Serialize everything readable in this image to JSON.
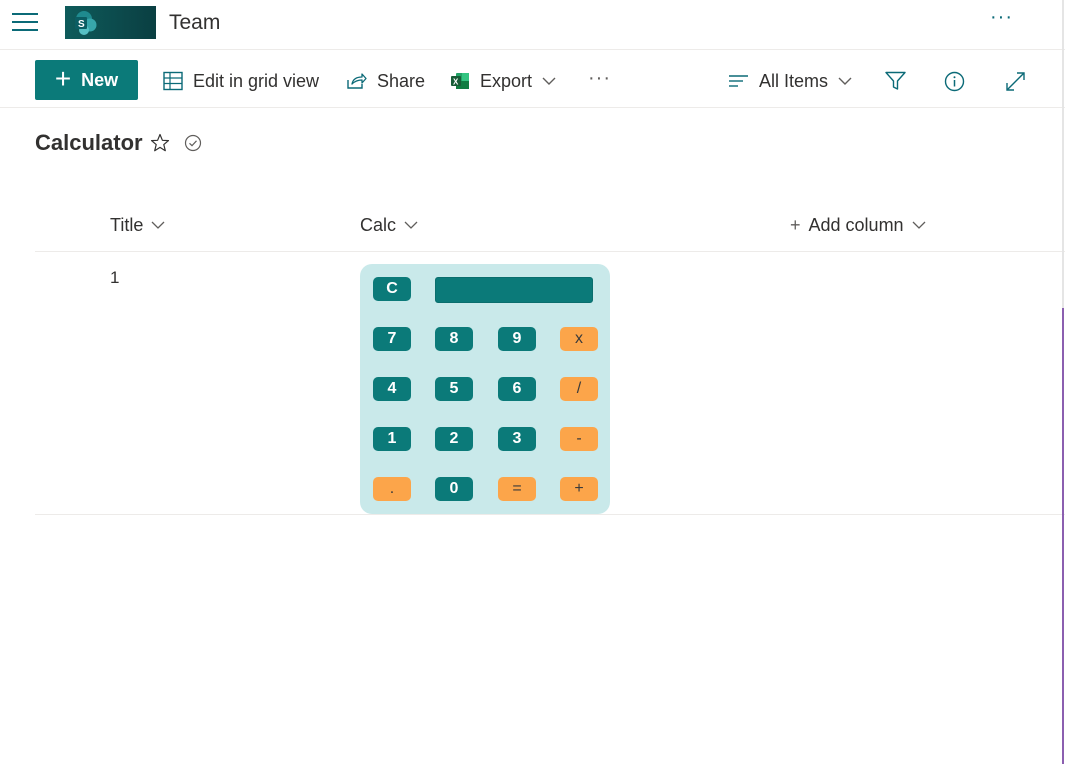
{
  "header": {
    "site_title": "Team",
    "more": "···"
  },
  "commandbar": {
    "new_label": "New",
    "new_plus": "+",
    "grid_view_label": "Edit in grid view",
    "share_label": "Share",
    "export_label": "Export",
    "more": "···",
    "view_label": "All Items"
  },
  "list": {
    "title": "Calculator",
    "columns": [
      {
        "label": "Title"
      },
      {
        "label": "Calc"
      },
      {
        "label": "Add column",
        "prefix": "+"
      }
    ],
    "rows": [
      {
        "title": "1"
      }
    ]
  },
  "calculator": {
    "display_value": "",
    "clear": "C",
    "keys": [
      [
        "7",
        "8",
        "9",
        "x"
      ],
      [
        "4",
        "5",
        "6",
        "/"
      ],
      [
        "1",
        "2",
        "3",
        "-"
      ],
      [
        ".",
        "0",
        "=",
        "+"
      ]
    ]
  },
  "colors": {
    "accent": "#0b7a79",
    "calc_bg": "#c9e9ea",
    "operator": "#fca54a"
  }
}
